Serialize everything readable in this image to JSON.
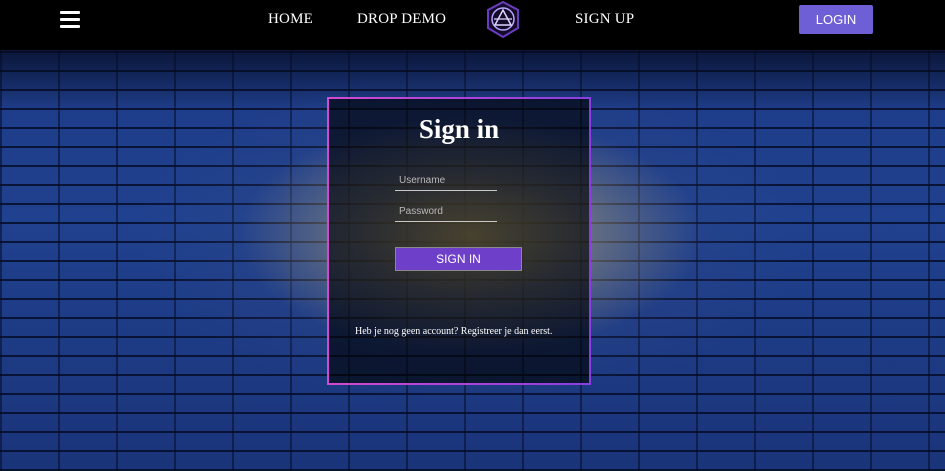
{
  "nav": {
    "menu_icon": "hamburger-menu-icon",
    "home_label": "HOME",
    "drop_demo_label": "DROP DEMO",
    "logo_icon": "brand-logo-icon",
    "sign_up_label": "SIGN UP",
    "login_label": "LOGIN"
  },
  "signin": {
    "title": "Sign in",
    "username_placeholder": "Username",
    "username_value": "",
    "password_placeholder": "Password",
    "password_value": "",
    "submit_label": "SIGN IN",
    "register_text": "Heb je nog geen account? Registreer je dan eerst."
  },
  "colors": {
    "accent": "#6e5fd6",
    "button": "#6e40c9",
    "card_border": "#b94fe0",
    "topbar": "#000000"
  }
}
